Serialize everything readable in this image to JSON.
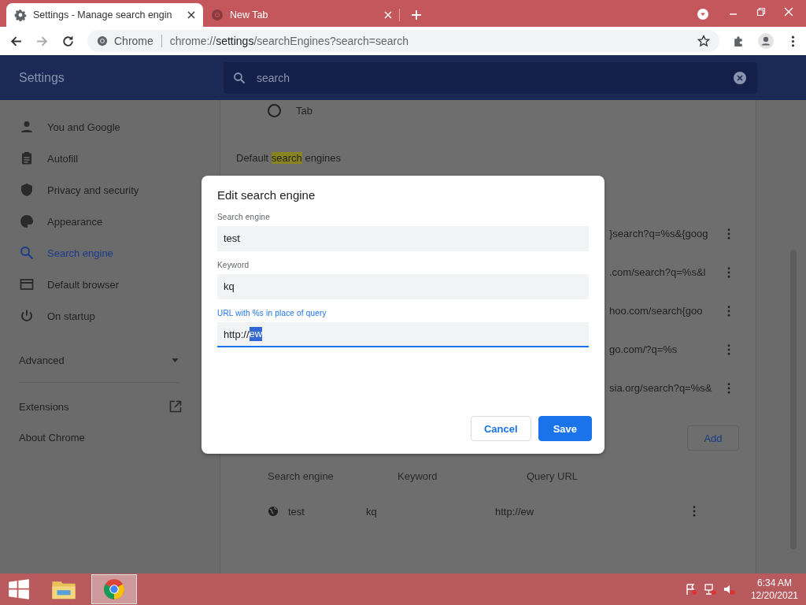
{
  "browser": {
    "tabs": [
      {
        "title": "Settings - Manage search engin",
        "selected": true,
        "kind": "settings"
      },
      {
        "title": "New Tab",
        "selected": false,
        "kind": "chrome"
      }
    ],
    "address": {
      "site_label": "Chrome",
      "url_host": "chrome://",
      "url_strong": "settings",
      "url_rest": "/searchEngines?search=search"
    }
  },
  "settings": {
    "title": "Settings",
    "search": {
      "value": "search"
    },
    "sidebar": {
      "items": [
        {
          "label": "You and Google",
          "selected": false,
          "kind": "person"
        },
        {
          "label": "Autofill",
          "selected": false,
          "kind": "clipboard"
        },
        {
          "label": "Privacy and security",
          "selected": false,
          "kind": "shield"
        },
        {
          "label": "Appearance",
          "selected": false,
          "kind": "palette"
        },
        {
          "label": "Search engine",
          "selected": true,
          "kind": "search"
        },
        {
          "label": "Default browser",
          "selected": false,
          "kind": "browser"
        },
        {
          "label": "On startup",
          "selected": false,
          "kind": "power"
        }
      ],
      "advanced": "Advanced",
      "extensions": "Extensions",
      "about": "About Chrome"
    },
    "content": {
      "radio": {
        "label": "Tab",
        "selected": false
      },
      "heading": [
        {
          "text": "Default ",
          "highlighted": false
        },
        {
          "text": "search",
          "highlighted": true
        },
        {
          "text": " engines",
          "highlighted": false
        }
      ],
      "default_engines": [
        {
          "query_url": "}search?q=%s&{goog"
        },
        {
          "query_url": ".com/search?q=%s&l"
        },
        {
          "query_url": "hoo.com/search{goo"
        },
        {
          "query_url": "go.com/?q=%s"
        },
        {
          "query_url": "sia.org/search?q=%s&"
        }
      ],
      "add_button": "Add",
      "other_engines": {
        "columns": [
          "Search engine",
          "Keyword",
          "Query URL"
        ],
        "rows": [
          {
            "name": "test",
            "keyword": "kq",
            "query_url": "http://ew"
          }
        ]
      }
    },
    "dialog": {
      "title": "Edit search engine",
      "fields": [
        {
          "label": "Search engine",
          "value": "test",
          "focused": false
        },
        {
          "label": "Keyword",
          "value": "kq",
          "focused": false
        },
        {
          "label": "URL with %s in place of query",
          "value": "http://",
          "selected_text": "ew",
          "focused": true
        }
      ],
      "buttons": [
        {
          "label": "Cancel",
          "kind": "secondary"
        },
        {
          "label": "Save",
          "kind": "primary"
        }
      ]
    }
  },
  "taskbar": {
    "time": "6:34 AM",
    "date": "12/20/2021"
  }
}
